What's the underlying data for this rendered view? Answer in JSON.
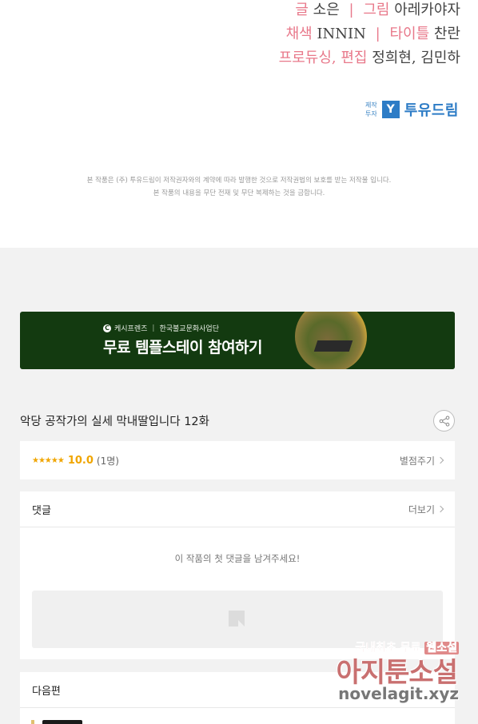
{
  "credits": {
    "line1": {
      "role_a": "글",
      "name_a": "소은",
      "separator": "|",
      "role_b": "그림",
      "name_b": "아레카야자"
    },
    "line2": {
      "role_a": "채색",
      "name_a": "INNIN",
      "separator": "|",
      "role_b": "타이틀",
      "name_b": "찬란"
    },
    "line3": {
      "role_a": "프로듀싱, 편집",
      "name_a": "정희현, 김민하"
    },
    "studio": {
      "sub_top": "제작",
      "sub_bottom": "투자",
      "mark": "Y",
      "name": "투유드림"
    },
    "copyright_line1": "본 작품은 (주) 투유드림이 저작권자와의 계약에 따라 발행한 것으로 저작권법의 보호를 받는 저작물 입니다.",
    "copyright_line2": "본 작품의 내용을 무단 전재 및 무단 복제하는 것을 금합니다."
  },
  "banner": {
    "brand_logo": "C",
    "brand_a": "케시프렌즈",
    "brand_sep": "|",
    "brand_b": "한국불교문화사업단",
    "title": "무료 템플스테이 참여하기"
  },
  "episode": {
    "title": "악당 공작가의 실세 막내딸입니다 12화",
    "share_icon": "share-icon"
  },
  "rating": {
    "stars": "★★★★★",
    "score": "10.0",
    "count": "(1명)",
    "action": "별점주기"
  },
  "comments": {
    "header": "댓글",
    "more": "더보기",
    "empty_message": "이 작품의 첫 댓글을 남겨주세요!"
  },
  "next": {
    "header": "다음편"
  },
  "watermark": {
    "top_a": "국내최초 무료",
    "top_b": "웹소설",
    "mid": "아지툰소설",
    "bot": "novelagit.xyz"
  },
  "colors": {
    "accent_pink": "#e8788a",
    "studio_blue": "#2d7cc6",
    "banner_green": "#133a10",
    "star_orange": "#f0a500"
  }
}
